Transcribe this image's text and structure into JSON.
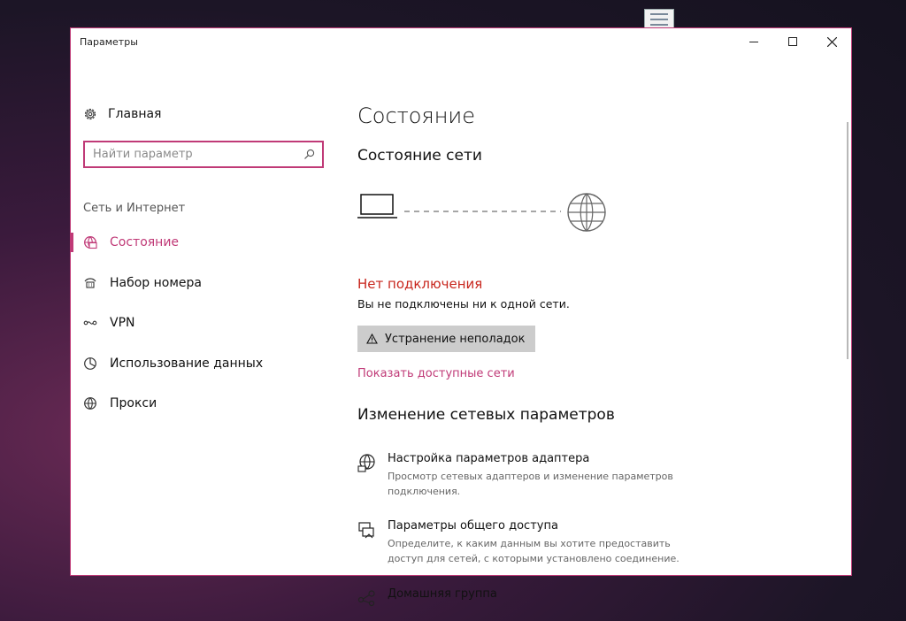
{
  "window": {
    "title": "Параметры"
  },
  "sidebar": {
    "home_label": "Главная",
    "search_placeholder": "Найти параметр",
    "section_label": "Сеть и Интернет",
    "items": [
      {
        "label": "Состояние",
        "icon": "network-status-icon",
        "active": true
      },
      {
        "label": "Набор номера",
        "icon": "dialup-icon",
        "active": false
      },
      {
        "label": "VPN",
        "icon": "vpn-icon",
        "active": false
      },
      {
        "label": "Использование данных",
        "icon": "data-usage-icon",
        "active": false
      },
      {
        "label": "Прокси",
        "icon": "globe-icon",
        "active": false
      }
    ]
  },
  "main": {
    "title": "Состояние",
    "network_status_heading": "Состояние сети",
    "no_connection": "Нет подключения",
    "no_connection_desc": "Вы не подключены ни к одной сети.",
    "troubleshoot_label": "Устранение неполадок",
    "show_networks_link": "Показать доступные сети",
    "change_heading": "Изменение сетевых параметров",
    "settings": [
      {
        "title": "Настройка параметров адаптера",
        "desc": "Просмотр сетевых адаптеров и изменение параметров подключения.",
        "icon": "adapter-globe-icon"
      },
      {
        "title": "Параметры общего доступа",
        "desc": "Определите, к каким данным вы хотите предоставить доступ для сетей, с которыми установлено соединение.",
        "icon": "sharing-icon"
      },
      {
        "title": "Домашняя группа",
        "desc": "",
        "icon": "homegroup-icon"
      }
    ]
  },
  "colors": {
    "accent": "#c03a77",
    "error": "#c8261d",
    "button_bg": "#cccccc"
  }
}
